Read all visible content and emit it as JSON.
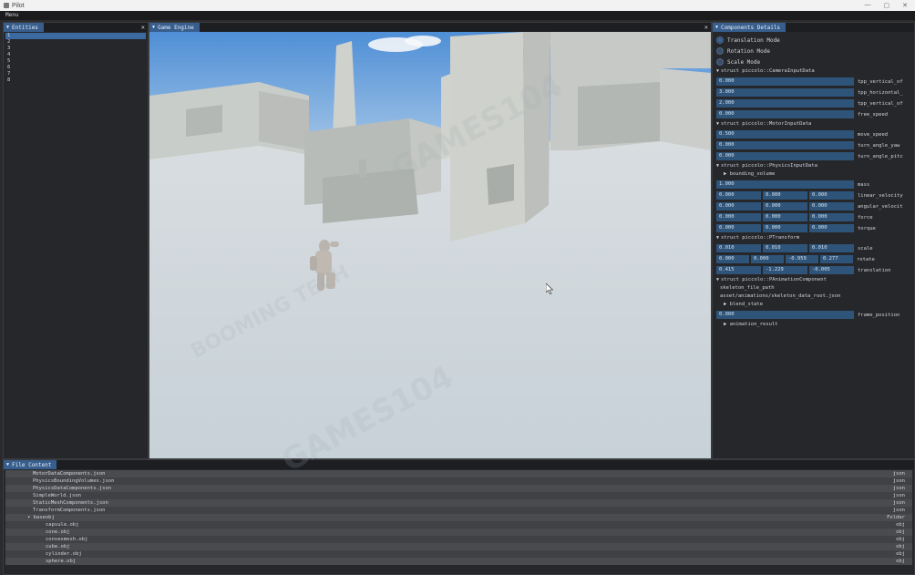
{
  "window": {
    "title": "Pilot",
    "menu_label": "Menu"
  },
  "entities": {
    "tab_label": "Entities",
    "items": [
      "1",
      "2",
      "3",
      "4",
      "5",
      "6",
      "7",
      "8"
    ],
    "selected_index": 0
  },
  "game": {
    "tab_label": "Game Engine"
  },
  "details": {
    "tab_label": "Components Details",
    "modes": [
      {
        "label": "Translation Mode",
        "selected": true
      },
      {
        "label": "Rotation Mode",
        "selected": false
      },
      {
        "label": "Scale Mode",
        "selected": false
      }
    ],
    "camera": {
      "header": "struct piccolo::CameraInputData",
      "fields": [
        {
          "value": "0.000",
          "label": "tpp_vertical_of"
        },
        {
          "value": "3.000",
          "label": "tpp_horizontal_"
        },
        {
          "value": "2.000",
          "label": "tpp_vertical_of"
        },
        {
          "value": "0.000",
          "label": "free_speed"
        }
      ]
    },
    "motor": {
      "header": "struct piccolo::MotorInputData",
      "fields": [
        {
          "value": "0.500",
          "label": "move_speed"
        },
        {
          "value": "0.000",
          "label": "turn_angle_yaw"
        },
        {
          "value": "0.000",
          "label": "turn_angle_pitc"
        }
      ]
    },
    "physics": {
      "header": "struct piccolo::PhysicsInputData",
      "sub": "bounding_volume",
      "mass": {
        "value": "1.000",
        "label": "mass"
      },
      "vec_fields": [
        {
          "values": [
            "0.000",
            "0.000",
            "0.000"
          ],
          "label": "linear_velocity"
        },
        {
          "values": [
            "0.000",
            "0.000",
            "0.000"
          ],
          "label": "angular_velocit"
        },
        {
          "values": [
            "0.000",
            "0.000",
            "0.000"
          ],
          "label": "force"
        },
        {
          "values": [
            "0.000",
            "0.000",
            "0.000"
          ],
          "label": "torque"
        }
      ]
    },
    "transform": {
      "header": "struct piccolo::PTransform",
      "scale": {
        "values": [
          "0.010",
          "0.010",
          "0.010"
        ],
        "label": "scale"
      },
      "rotate": {
        "values": [
          "0.000",
          "0.000",
          "-0.959",
          "0.277"
        ],
        "label": "rotate"
      },
      "translation": {
        "values": [
          "0.415",
          "-1.229",
          "-0.005"
        ],
        "label": "translation"
      }
    },
    "animation": {
      "header": "struct piccolo::PAnimationComponent",
      "skeleton_label": "skeleton_file_path",
      "skeleton_path": "asset/animations/skeleton_data_root.json",
      "blend_state": "blend_state",
      "frame_position": {
        "value": "0.000",
        "label": "frame_position"
      },
      "animation_result": "animation_result"
    }
  },
  "files": {
    "tab_label": "File Content",
    "rows": [
      {
        "name": "MotorDataComponents.json",
        "type": "json",
        "level": 1
      },
      {
        "name": "PhysicsBoundingVolumes.json",
        "type": "json",
        "level": 1
      },
      {
        "name": "PhysicsDataComponents.json",
        "type": "json",
        "level": 1
      },
      {
        "name": "SimpleWorld.json",
        "type": "json",
        "level": 1
      },
      {
        "name": "StaticMeshComponents.json",
        "type": "json",
        "level": 1
      },
      {
        "name": "TransformComponents.json",
        "type": "json",
        "level": 1
      },
      {
        "name": "▾ baseobj",
        "type": "Folder",
        "level": 0
      },
      {
        "name": "capsule.obj",
        "type": "obj",
        "level": 2
      },
      {
        "name": "cone.obj",
        "type": "obj",
        "level": 2
      },
      {
        "name": "convexmesh.obj",
        "type": "obj",
        "level": 2
      },
      {
        "name": "cube.obj",
        "type": "obj",
        "level": 2
      },
      {
        "name": "cylinder.obj",
        "type": "obj",
        "level": 2
      },
      {
        "name": "sphere.obj",
        "type": "obj",
        "level": 2
      }
    ]
  },
  "watermarks": [
    "GAMES104",
    "BOOMING TECH"
  ]
}
